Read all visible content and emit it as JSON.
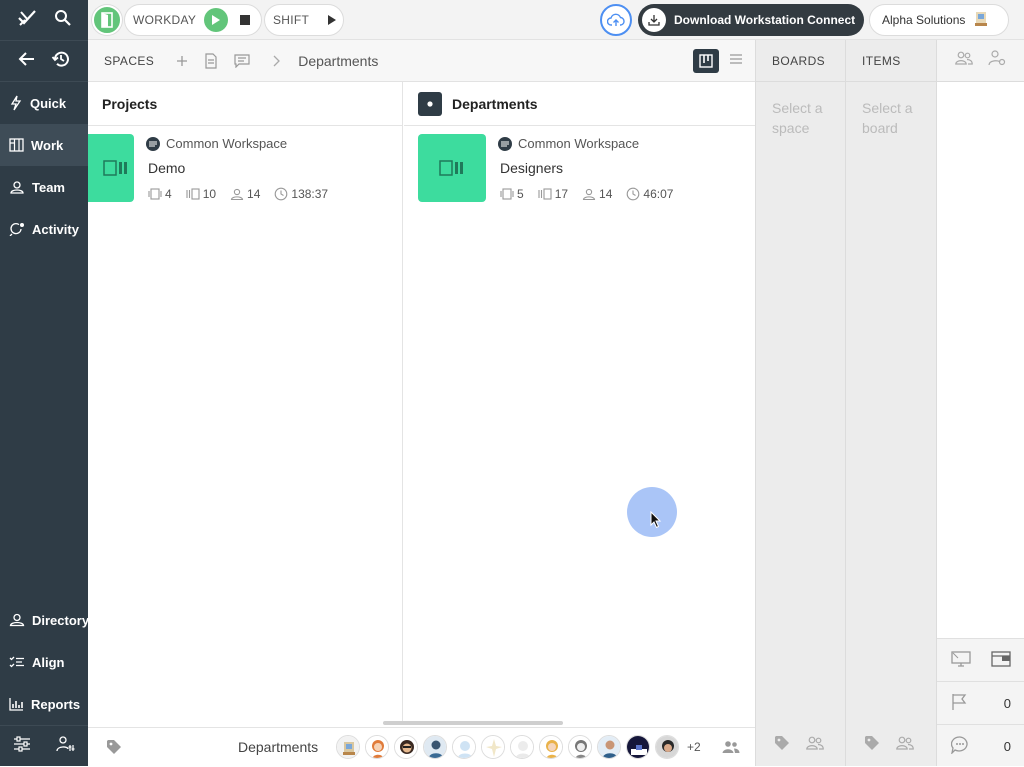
{
  "topbar": {
    "workday_label": "WORKDAY",
    "shift_label": "SHIFT",
    "download_label": "Download Workstation Connect",
    "org_name": "Alpha Solutions"
  },
  "sidebar": {
    "items": [
      {
        "label": "Quick",
        "icon": "bolt-icon"
      },
      {
        "label": "Work",
        "icon": "board-icon",
        "active": true
      },
      {
        "label": "Team",
        "icon": "team-icon"
      },
      {
        "label": "Activity",
        "icon": "activity-icon"
      }
    ],
    "bottom_items": [
      {
        "label": "Directory",
        "icon": "directory-icon"
      },
      {
        "label": "Align",
        "icon": "align-icon"
      },
      {
        "label": "Reports",
        "icon": "reports-icon"
      }
    ]
  },
  "spaces_header": {
    "label": "SPACES",
    "breadcrumb": "Departments"
  },
  "columns": {
    "projects": {
      "title": "Projects",
      "card": {
        "workspace": "Common Workspace",
        "name": "Demo",
        "stat1": "4",
        "stat2": "10",
        "members": "14",
        "time": "138:37"
      }
    },
    "departments": {
      "title": "Departments",
      "card": {
        "workspace": "Common Workspace",
        "name": "Designers",
        "stat1": "5",
        "stat2": "17",
        "members": "14",
        "time": "46:07"
      }
    }
  },
  "boards": {
    "label": "BOARDS",
    "placeholder": "Select a space"
  },
  "items": {
    "label": "ITEMS",
    "placeholder": "Select a board"
  },
  "right_panel": {
    "flag_count": "0",
    "comment_count": "0"
  },
  "bottombar": {
    "label": "Departments",
    "more_count": "+2"
  },
  "colors": {
    "sidebar": "#2f3c46",
    "accent_green": "#3ddc9e",
    "play_green": "#62c57a",
    "cloud_blue": "#4d8ff2"
  }
}
